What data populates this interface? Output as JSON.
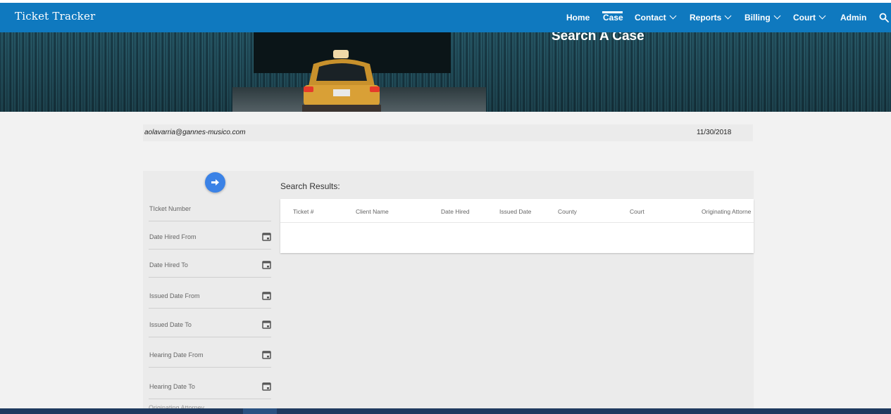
{
  "app": {
    "title": "Ticket Tracker"
  },
  "nav": {
    "items": [
      {
        "label": "Home",
        "dropdown": false
      },
      {
        "label": "Case",
        "dropdown": false,
        "active": true
      },
      {
        "label": "Contact",
        "dropdown": true
      },
      {
        "label": "Reports",
        "dropdown": true
      },
      {
        "label": "Billing",
        "dropdown": true
      },
      {
        "label": "Court",
        "dropdown": true
      },
      {
        "label": "Admin",
        "dropdown": false
      }
    ],
    "search_icon": "search-icon"
  },
  "hero": {
    "title": "Search A Case"
  },
  "info": {
    "email": "aolavarria@gannes-musico.com",
    "date": "11/30/2018"
  },
  "filters": [
    {
      "label": "TIcket Number",
      "calendar": false
    },
    {
      "label": "Date Hired From",
      "calendar": true
    },
    {
      "label": "Date Hired To",
      "calendar": true
    },
    {
      "label": "Issued Date From",
      "calendar": true
    },
    {
      "label": "Issued Date To",
      "calendar": true
    },
    {
      "label": "Hearing Date From",
      "calendar": true
    },
    {
      "label": "Hearing Date To",
      "calendar": true
    },
    {
      "label": "Originating Attorney",
      "calendar": false
    }
  ],
  "results": {
    "label": "Search Results:",
    "columns": [
      "Ticket #",
      "Client Name",
      "Date Hired",
      "Issued Date",
      "County",
      "Court",
      "Originating Attorne"
    ]
  },
  "colors": {
    "nav": "#0f79bf",
    "button": "#3b82e6",
    "footer": "#1f3a5f"
  }
}
